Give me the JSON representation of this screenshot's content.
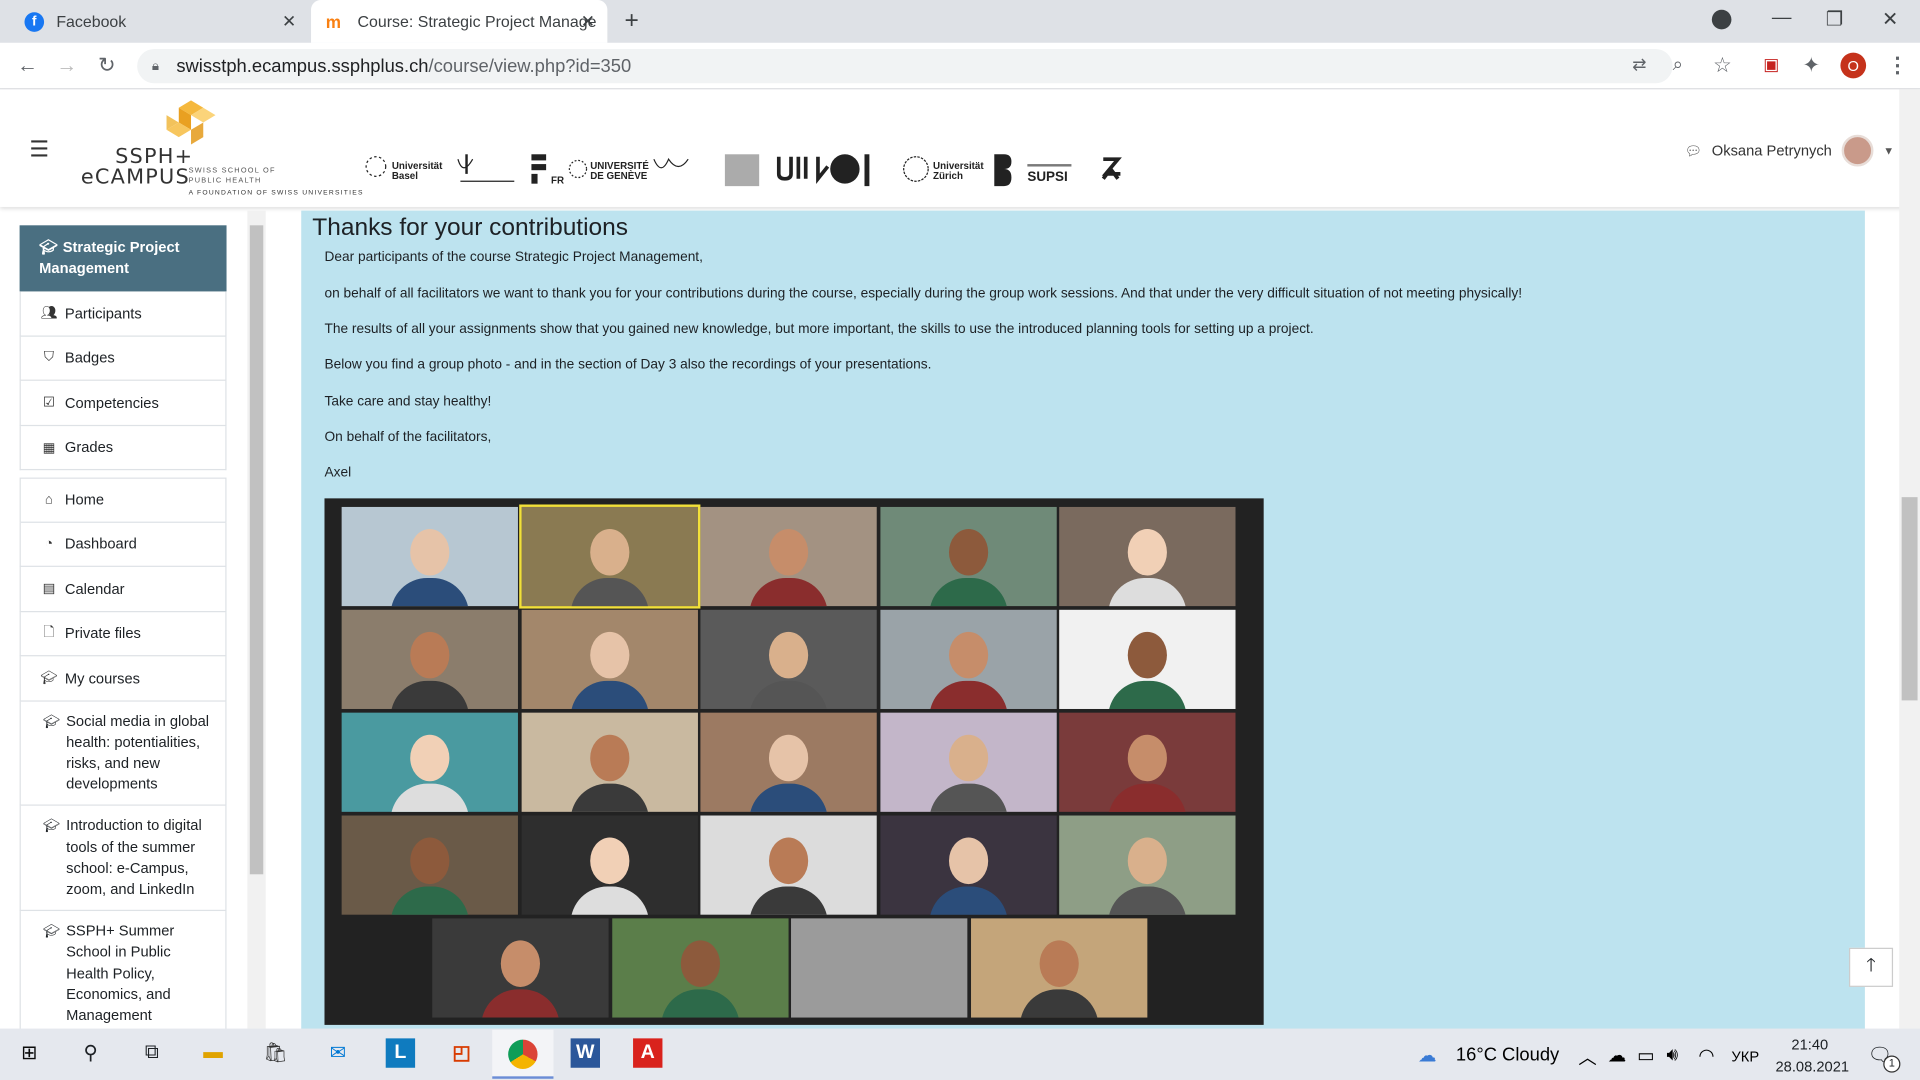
{
  "browser": {
    "tabs": [
      {
        "title": "Facebook",
        "active": false
      },
      {
        "title": "Course: Strategic Project Manage",
        "active": true
      }
    ],
    "url_host": "swisstph.ecampus.ssphplus.ch",
    "url_path": "/course/view.php?id=350",
    "profile_initial": "O"
  },
  "header": {
    "logo_line1": "SSPH+",
    "logo_line2": "eCAMPUS",
    "logo_sub1": "SWISS SCHOOL OF",
    "logo_sub2": "PUBLIC HEALTH",
    "logo_tagline": "A FOUNDATION OF SWISS UNIVERSITIES",
    "user_name": "Oksana Petrynych"
  },
  "sidebar": {
    "course_title": "Strategic Project Management",
    "course_items": [
      {
        "label": "Participants",
        "icon": "users-icon"
      },
      {
        "label": "Badges",
        "icon": "shield-icon"
      },
      {
        "label": "Competencies",
        "icon": "check-icon"
      },
      {
        "label": "Grades",
        "icon": "table-icon"
      }
    ],
    "nav_items": [
      {
        "label": "Home",
        "icon": "home-icon"
      },
      {
        "label": "Dashboard",
        "icon": "dashboard-icon"
      },
      {
        "label": "Calendar",
        "icon": "calendar-icon"
      },
      {
        "label": "Private files",
        "icon": "file-icon"
      },
      {
        "label": "My courses",
        "icon": "graduation-cap-icon"
      }
    ],
    "courses": [
      "Social media in global health: potentialities, risks, and new developments",
      "Introduction to digital tools of the summer school: e-Campus, zoom, and LinkedIn",
      "SSPH+ Summer School in Public Health Policy, Economics, and Management"
    ]
  },
  "main": {
    "heading": "Thanks for your contributions",
    "paragraphs": [
      "Dear participants of the course Strategic Project Management,",
      "on behalf of all facilitators we want to thank you for your contributions during the course, especially during the group work sessions. And that under the very difficult situation of not meeting physically!",
      "The results of all your assignments show that you gained new knowledge, but more important, the skills to use the introduced planning tools for setting up a project.",
      "Below you find a group photo - and in the section of Day 3 also the recordings of your presentations.",
      "Take care and stay healthy!",
      "On behalf of the facilitators,",
      "Axel"
    ]
  },
  "taskbar": {
    "weather": "16°C  Cloudy",
    "lang": "УКР",
    "time": "21:40",
    "date": "28.08.2021",
    "notifications": "1"
  }
}
